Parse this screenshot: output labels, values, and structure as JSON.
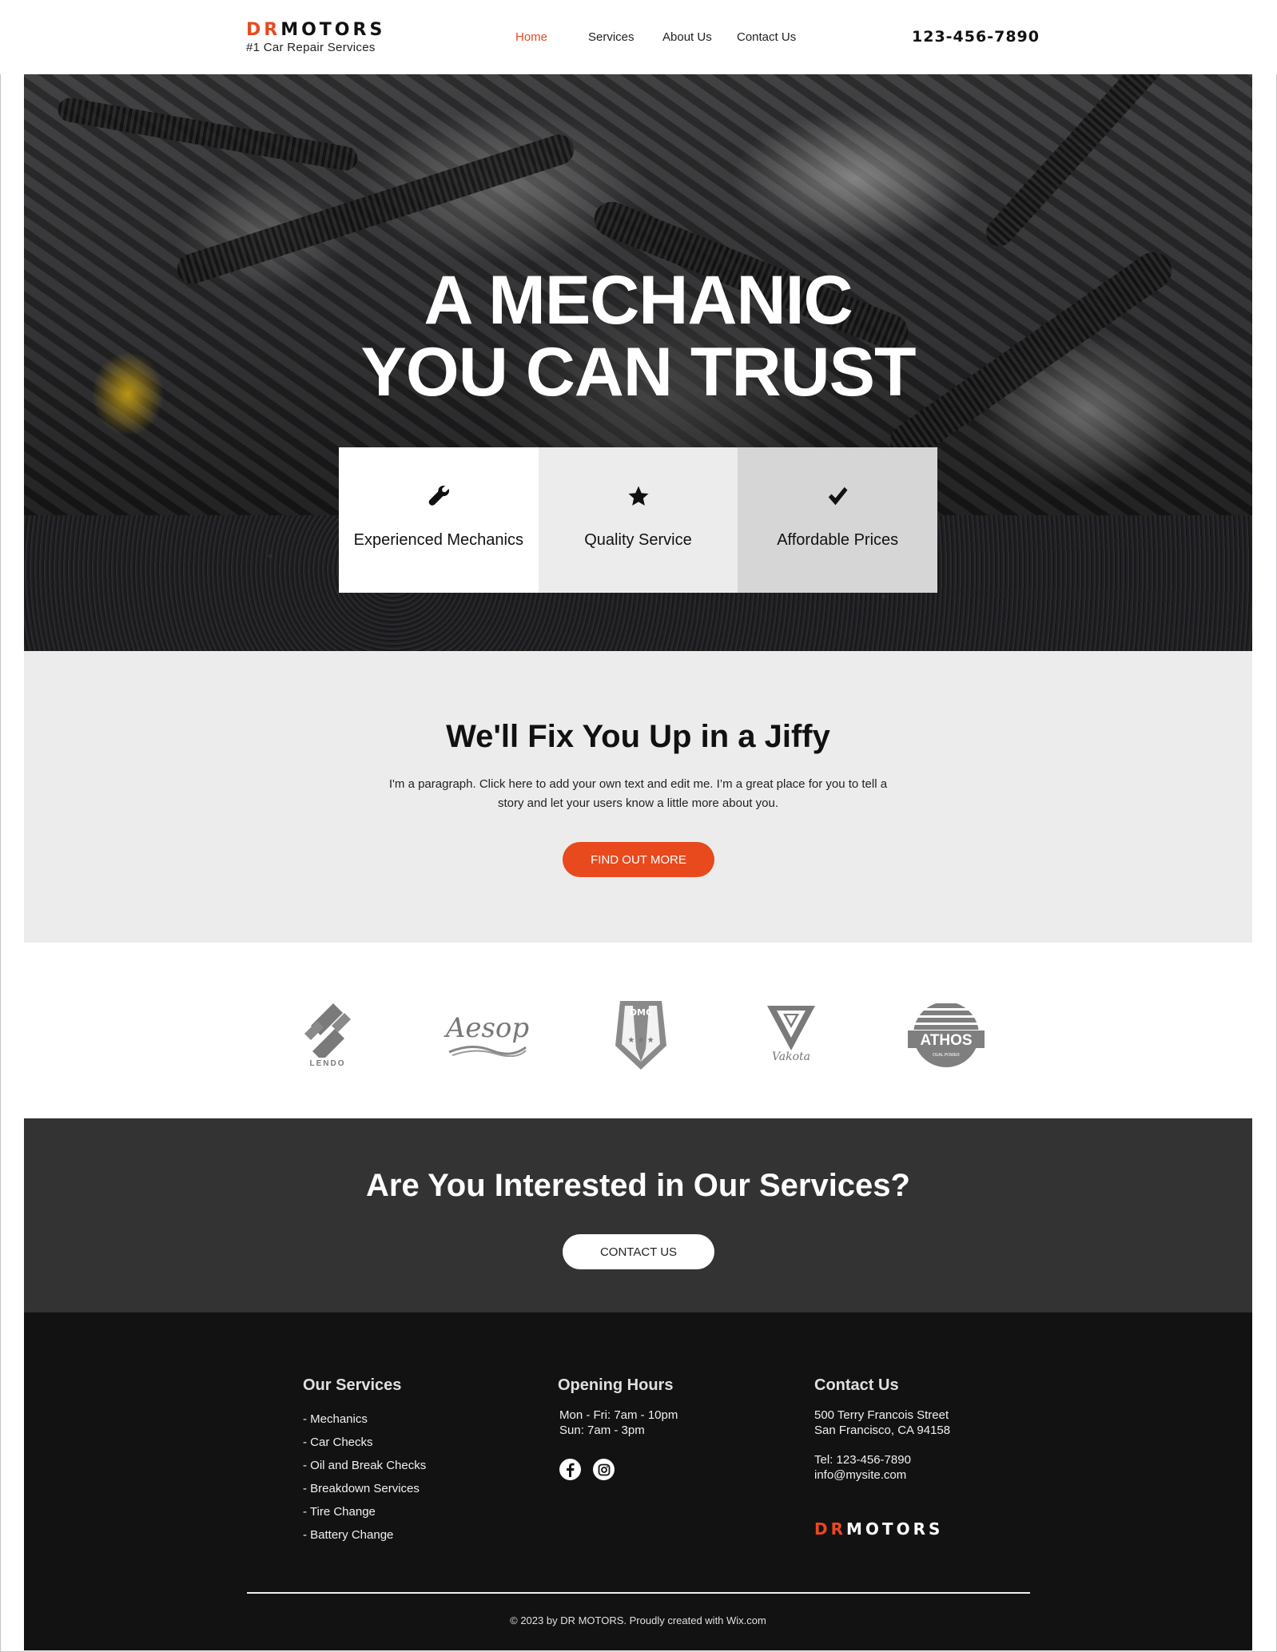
{
  "header": {
    "logo_dr": "DR",
    "logo_motors": "MOTORS",
    "tagline": "#1 Car Repair Services",
    "nav": [
      {
        "label": "Home",
        "active": true
      },
      {
        "label": "Services",
        "active": false
      },
      {
        "label": "About Us",
        "active": false
      },
      {
        "label": "Contact Us",
        "active": false
      }
    ],
    "phone": "123-456-7890"
  },
  "hero": {
    "title_line1": "A MECHANIC",
    "title_line2": "YOU CAN TRUST",
    "features": [
      {
        "icon": "wrench-icon",
        "label": "Experienced Mechanics"
      },
      {
        "icon": "star-icon",
        "label": "Quality Service"
      },
      {
        "icon": "checkmark-icon",
        "label": "Affordable Prices"
      }
    ]
  },
  "intro": {
    "heading": "We'll Fix You Up in a Jiffy",
    "paragraph": "I'm a paragraph. Click here to add your own text and edit me. I’m a great place for you to tell a story and let your users know a little more about you.",
    "button": "FIND OUT MORE"
  },
  "brands": [
    {
      "name": "LENDO"
    },
    {
      "name": "Aesop"
    },
    {
      "name": "DMC"
    },
    {
      "name": "Vakota"
    },
    {
      "name": "ATHOS",
      "sub": "DUAL POWER"
    }
  ],
  "cta": {
    "heading": "Are You Interested in Our Services?",
    "button": "CONTACT US"
  },
  "footer": {
    "services": {
      "heading": "Our Services",
      "items": [
        "- Mechanics",
        "- Car Checks",
        "- Oil and Break Checks",
        "- Breakdown Services",
        "- Tire Change",
        "- Battery Change"
      ]
    },
    "hours": {
      "heading": "Opening Hours",
      "lines": [
        "Mon - Fri: 7am - 10pm",
        "Sun: 7am - 3pm"
      ],
      "social": [
        "facebook-icon",
        "instagram-icon"
      ]
    },
    "contact": {
      "heading": "Contact Us",
      "address_line1": "500 Terry Francois Street",
      "address_line2": "San Francisco, CA 94158",
      "tel": "Tel: 123-456-7890",
      "email": "info@mysite.com",
      "logo_dr": "DR",
      "logo_motors": "MOTORS"
    },
    "copyright": "© 2023 by DR MOTORS. Proudly created with Wix.com"
  },
  "colors": {
    "accent": "#e8491d",
    "section_gray": "#ececec",
    "cta_bg": "#333333",
    "footer_bg": "#121212"
  }
}
